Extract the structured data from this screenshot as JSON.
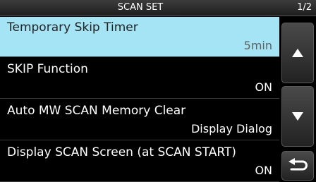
{
  "header": {
    "title": "SCAN SET",
    "page_indicator": "1/2"
  },
  "items": [
    {
      "label": "Temporary Skip Timer",
      "value": "5min",
      "selected": true
    },
    {
      "label": "SKIP Function",
      "value": "ON",
      "selected": false
    },
    {
      "label": "Auto MW SCAN Memory Clear",
      "value": "Display Dialog",
      "selected": false
    },
    {
      "label": "Display SCAN Screen (at SCAN START)",
      "value": "ON",
      "selected": false
    }
  ],
  "scroll_buttons": {
    "up_icon": "triangle-up-icon",
    "down_icon": "triangle-down-icon",
    "back_icon": "return-arrow-icon"
  },
  "colors": {
    "selected_bg": "#a4e4f4",
    "background": "#000000"
  }
}
